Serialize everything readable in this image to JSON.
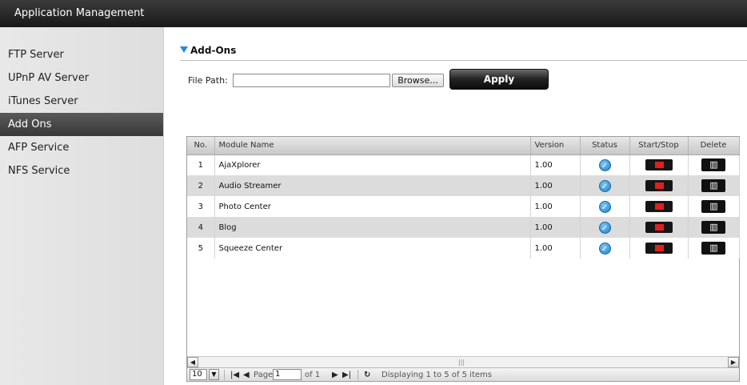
{
  "window": {
    "title": "Application Management"
  },
  "sidebar": {
    "items": [
      {
        "label": "FTP Server",
        "active": false
      },
      {
        "label": "UPnP AV Server",
        "active": false
      },
      {
        "label": "iTunes Server",
        "active": false
      },
      {
        "label": "Add Ons",
        "active": true
      },
      {
        "label": "AFP Service",
        "active": false
      },
      {
        "label": "NFS Service",
        "active": false
      }
    ]
  },
  "section": {
    "title": "Add-Ons"
  },
  "file_upload": {
    "label": "File Path:",
    "value": "",
    "browse_label": "Browse...",
    "apply_label": "Apply"
  },
  "table": {
    "columns": [
      "No.",
      "Module Name",
      "Version",
      "Status",
      "Start/Stop",
      "Delete"
    ],
    "rows": [
      {
        "no": "1",
        "name": "AjaXplorer",
        "version": "1.00",
        "status_icon": "check-icon",
        "start_stop_icon": "stop-icon",
        "delete_icon": "trash-icon"
      },
      {
        "no": "2",
        "name": "Audio Streamer",
        "version": "1.00",
        "status_icon": "check-icon",
        "start_stop_icon": "stop-icon",
        "delete_icon": "trash-icon"
      },
      {
        "no": "3",
        "name": "Photo Center",
        "version": "1.00",
        "status_icon": "check-icon",
        "start_stop_icon": "stop-icon",
        "delete_icon": "trash-icon"
      },
      {
        "no": "4",
        "name": "Blog",
        "version": "1.00",
        "status_icon": "check-icon",
        "start_stop_icon": "stop-icon",
        "delete_icon": "trash-icon"
      },
      {
        "no": "5",
        "name": "Squeeze Center",
        "version": "1.00",
        "status_icon": "check-icon",
        "start_stop_icon": "stop-icon",
        "delete_icon": "trash-icon"
      }
    ]
  },
  "pager": {
    "page_size": "10",
    "page_label": "Page",
    "page_value": "1",
    "of_label": "of 1",
    "display_text": "Displaying 1 to 5 of 5 items"
  },
  "colors": {
    "accent": "#2a8ad6",
    "active_nav": "#444444",
    "stop_red": "#e02020"
  }
}
